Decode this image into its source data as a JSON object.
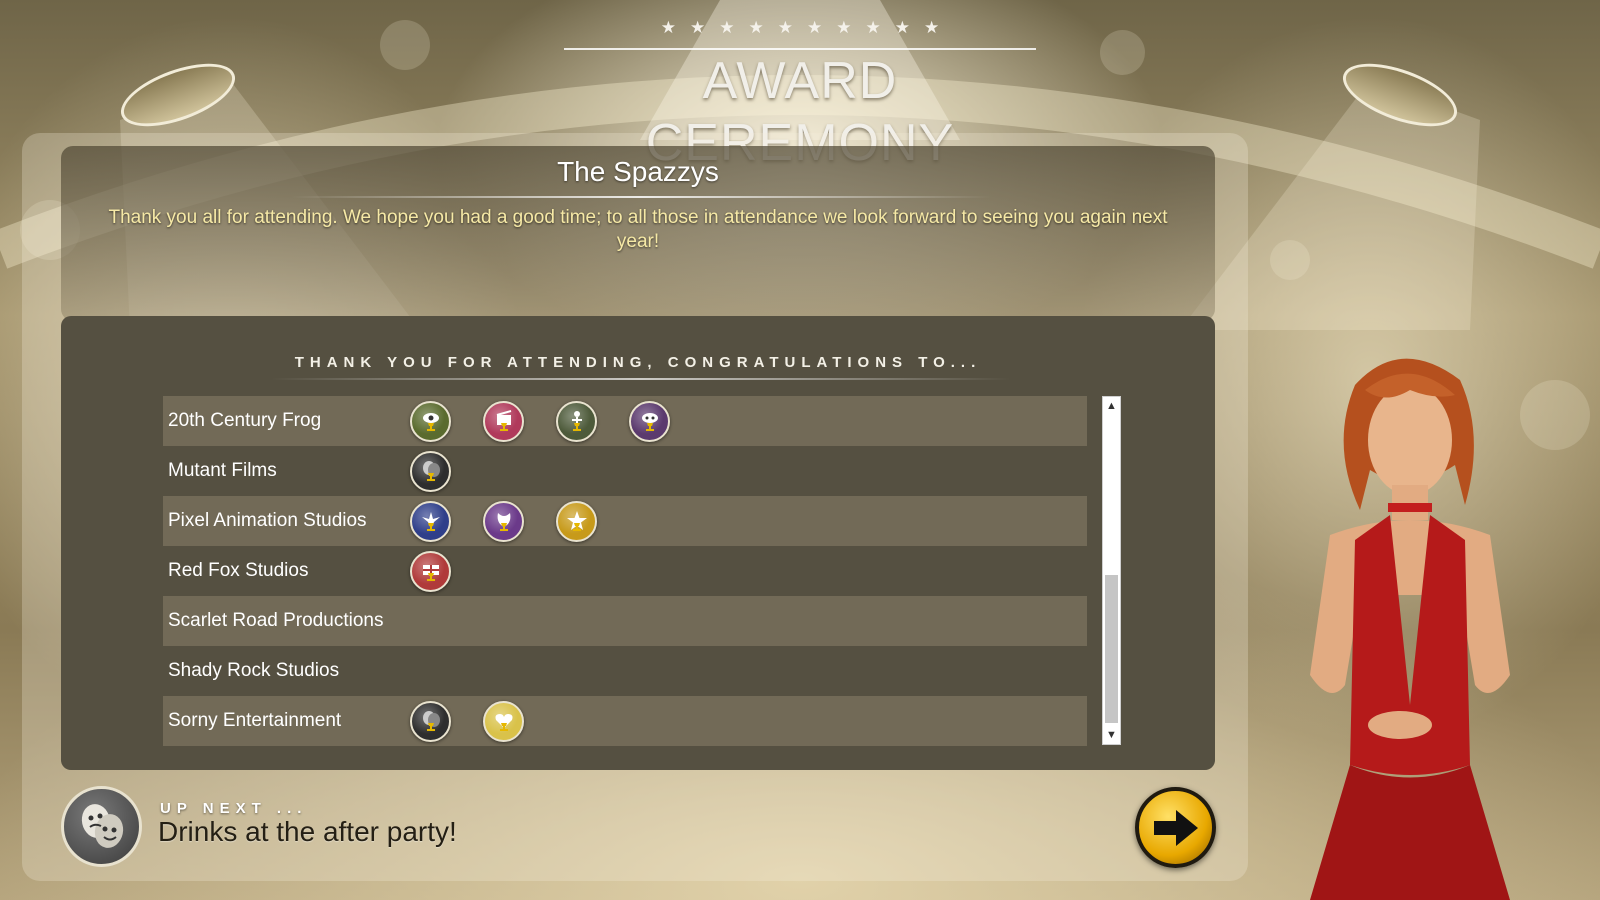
{
  "header": {
    "stars": [
      "★",
      "★",
      "★",
      "★",
      "★",
      "★",
      "★",
      "★",
      "★",
      "★"
    ],
    "title": "AWARD CEREMONY"
  },
  "ceremony": {
    "name": "The Spazzys",
    "message": "Thank you all for attending. We hope you had a good time; to all those in attendance we look forward to seeing you again next year!"
  },
  "list": {
    "heading": "THANK YOU FOR ATTENDING, CONGRATULATIONS TO...",
    "rows": [
      {
        "name": "20th Century Frog",
        "awards": [
          {
            "icon": "eye-award-icon",
            "color": "#5a6b2e"
          },
          {
            "icon": "clapperboard-award-icon",
            "color": "#b03a5b"
          },
          {
            "icon": "figure-award-icon",
            "color": "#4d5a3a"
          },
          {
            "icon": "mask-award-icon",
            "color": "#5b3a6e"
          }
        ]
      },
      {
        "name": "Mutant Films",
        "awards": [
          {
            "icon": "theatre-masks-award-icon",
            "color": "#2e2e2e"
          }
        ]
      },
      {
        "name": "Pixel Animation Studios",
        "awards": [
          {
            "icon": "fairy-award-icon",
            "color": "#2f3f8a"
          },
          {
            "icon": "creature-award-icon",
            "color": "#6b3a8a"
          },
          {
            "icon": "star-award-icon",
            "color": "#c79a1a"
          }
        ]
      },
      {
        "name": "Red Fox Studios",
        "awards": [
          {
            "icon": "flag-award-icon",
            "color": "#b03a3a"
          }
        ]
      },
      {
        "name": "Scarlet Road Productions",
        "awards": []
      },
      {
        "name": "Shady Rock Studios",
        "awards": []
      },
      {
        "name": "Sorny Entertainment",
        "awards": [
          {
            "icon": "theatre-masks-award-icon",
            "color": "#2e2e2e"
          },
          {
            "icon": "heart-award-icon",
            "color": "#d9c24a"
          }
        ]
      }
    ],
    "scroll_up": "▲",
    "scroll_down": "▼"
  },
  "footer": {
    "up_next_label": "UP NEXT ...",
    "up_next_text": "Drinks at the after party!"
  }
}
